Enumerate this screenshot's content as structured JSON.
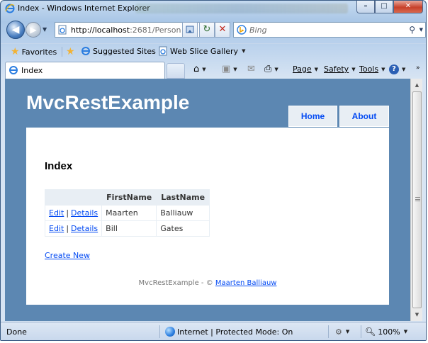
{
  "window": {
    "title": "Index - Windows Internet Explorer",
    "buttons": {
      "minimize": "–",
      "maximize": "□",
      "close": "✕"
    }
  },
  "navigation": {
    "address": {
      "host": "http://localhost",
      "rest": ":2681/Person"
    },
    "search": {
      "placeholder": "Bing"
    }
  },
  "favorites_bar": {
    "favorites_label": "Favorites",
    "items": [
      {
        "label": "Suggested Sites",
        "icon": "ie-icon"
      },
      {
        "label": "Web Slice Gallery",
        "icon": "ie-page-icon"
      }
    ]
  },
  "tab": {
    "label": "Index"
  },
  "command_bar": {
    "page_label": "Page",
    "safety_label": "Safety",
    "tools_label": "Tools"
  },
  "site": {
    "title": "MvcRestExample",
    "menu": [
      "Home",
      "About"
    ]
  },
  "content": {
    "heading": "Index",
    "table": {
      "columns": [
        "",
        "FirstName",
        "LastName"
      ],
      "rows": [
        {
          "edit": "Edit",
          "details": "Details",
          "first": "Maarten",
          "last": "Balliauw"
        },
        {
          "edit": "Edit",
          "details": "Details",
          "first": "Bill",
          "last": "Gates"
        }
      ]
    },
    "create_new": "Create New",
    "footer_prefix": "MvcRestExample - ©",
    "footer_link": "Maarten Balliauw"
  },
  "status_bar": {
    "status": "Done",
    "zone": "Internet | Protected Mode: On",
    "zoom": "100%"
  },
  "colors": {
    "page_background": "#5c87b2",
    "link": "#034af3",
    "menu_background": "#e8eef4"
  }
}
